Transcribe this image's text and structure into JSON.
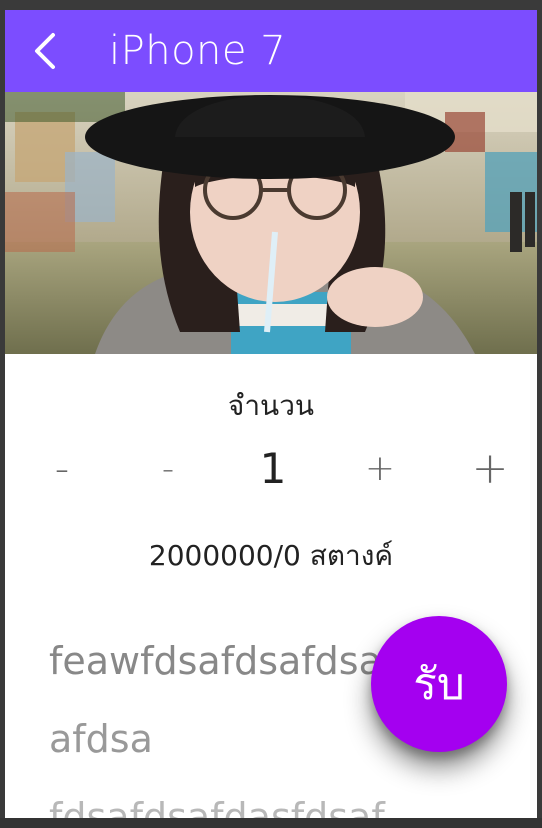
{
  "app_bar": {
    "title": "iPhone 7",
    "back_icon": "chevron-left-icon",
    "color": "#7c4dff"
  },
  "product_image": {
    "icon": "photo-image"
  },
  "quantity": {
    "label": "จำนวน",
    "value": "1",
    "decrement_label": "-",
    "decrement_large_label": "-",
    "increment_label": "+",
    "increment_large_label": "+"
  },
  "price": {
    "text": "2000000/0 สตางค์"
  },
  "description": {
    "lines": [
      "feawfdsafdsafdsafdsa",
      "afdsa",
      "fdsafdsafdasfdsaf"
    ]
  },
  "fab": {
    "label": "รับ",
    "color": "#a400f0"
  }
}
